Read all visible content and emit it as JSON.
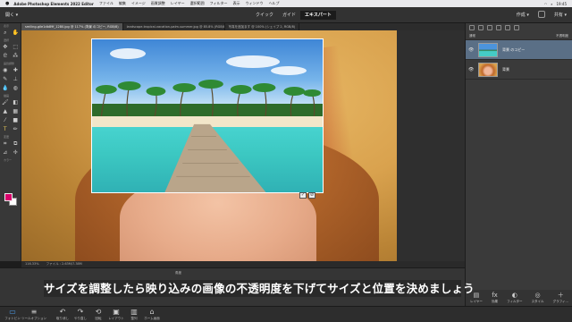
{
  "menubar": {
    "app": "Adobe Photoshop Elements 2022 Editor",
    "items": [
      "ファイル",
      "編集",
      "イメージ",
      "画質調整",
      "レイヤー",
      "選択範囲",
      "フィルター",
      "表示",
      "ウィンドウ",
      "ヘルプ"
    ],
    "clock": "19:45"
  },
  "topbar": {
    "open_label": "開く",
    "modes": [
      "クイック",
      "ガイド",
      "エキスパート"
    ],
    "active_mode": "エキスパート",
    "create_label": "作成",
    "share_label": "共有"
  },
  "tabs": [
    "smiling-gile1db89f_1280.jpg @ 117% (背景 のコピー, RGB/8)",
    "landscape-tropical-vacation-palm-summer.jpg @ 85.8% (RGB/8)",
    "写真を追加ます @ 100% (シェイプ 2, RGB/8)"
  ],
  "toolbar": {
    "sections": [
      "表示",
      "選択",
      "画質調整",
      "描画",
      "変更",
      "カラー"
    ]
  },
  "colors": {
    "foreground": "#d8006b",
    "background": "#ffffff",
    "accent": "#5a6f86"
  },
  "layers_panel": {
    "blend_mode": "通常",
    "opacity_label": "不透明度",
    "layers": [
      {
        "name": "背景 のコピー",
        "selected": true
      },
      {
        "name": "背景",
        "selected": false
      }
    ],
    "bottom_buttons": [
      "レイヤー",
      "効果",
      "フィルター",
      "スタイル",
      "グラフィ..."
    ]
  },
  "statusbar": {
    "zoom": "116.33%",
    "doc": "ファイル : 2.63M/7.38M"
  },
  "options_label": "角度",
  "bottom_buttons": [
    "フォトビン",
    "ツールオプション",
    "取り消し",
    "やり直し",
    "回転",
    "レイアウト",
    "整列",
    "ホーム画面"
  ],
  "caption": "サイズを調整したら映り込みの画像の不透明度を下げてサイズと位置を決めましょう"
}
